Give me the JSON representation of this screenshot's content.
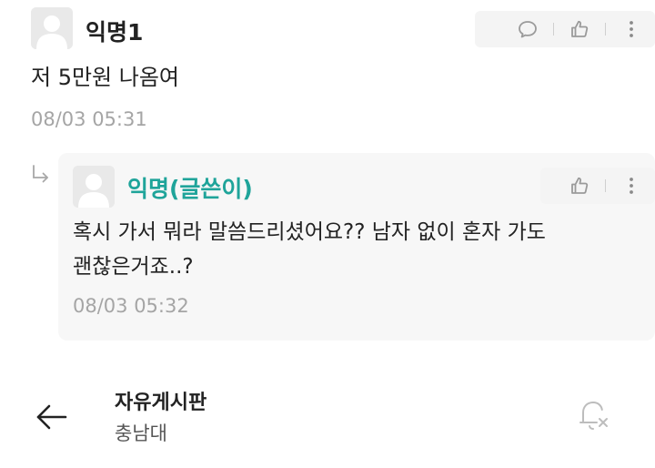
{
  "comment": {
    "nickname": "익명1",
    "content": "저 5만원 나옴여",
    "timestamp": "08/03 05:31",
    "icons": {
      "avatar": "default-avatar",
      "comment": "speech-bubble-icon",
      "like": "thumbs-up-icon",
      "more": "more-vertical-icon"
    }
  },
  "reply": {
    "nickname": "익명(글쓴이)",
    "content_line1": "혹시 가서 뭐라 말씀드리셨어요?? 남자 없이 혼자 가도",
    "content_line2": "괜찮은거죠..?",
    "timestamp": "08/03 05:32",
    "icons": {
      "reply_arrow": "reply-arrow-icon",
      "like": "thumbs-up-icon",
      "more": "more-vertical-icon"
    }
  },
  "bottom_bar": {
    "board_name": "자유게시판",
    "school_name": "충남대",
    "icons": {
      "back": "back-arrow-icon",
      "notification": "bell-off-icon"
    }
  },
  "colors": {
    "author_nick": "#1fa49a",
    "timestamp": "#a5a5a5",
    "icon_gray": "#9a9a9a"
  }
}
